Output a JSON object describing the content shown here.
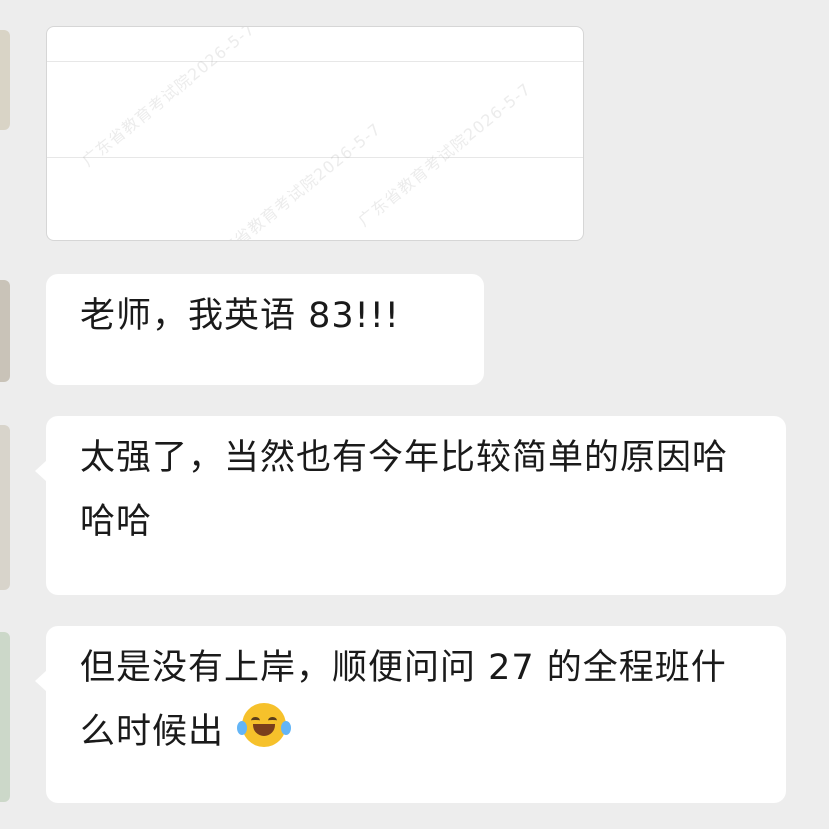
{
  "watermark": {
    "line1": "广东省教育考试院2026-5-7",
    "line2": "广东省教育考试院2026-5-7",
    "line3": "广东省教育考试院2026-5-7"
  },
  "messages": [
    {
      "text": "老师，我英语 83!!!"
    },
    {
      "text": "太强了，当然也有今年比较简单的原因哈哈哈"
    },
    {
      "text": " 但是没有上岸，顺便问问 27 的全程班什么时候出",
      "emoji": "laughing-with-tears"
    }
  ],
  "colors": {
    "background": "#ededed",
    "bubble": "#ffffff",
    "text": "#1a1a1a",
    "emoji": "#f6c12b"
  }
}
